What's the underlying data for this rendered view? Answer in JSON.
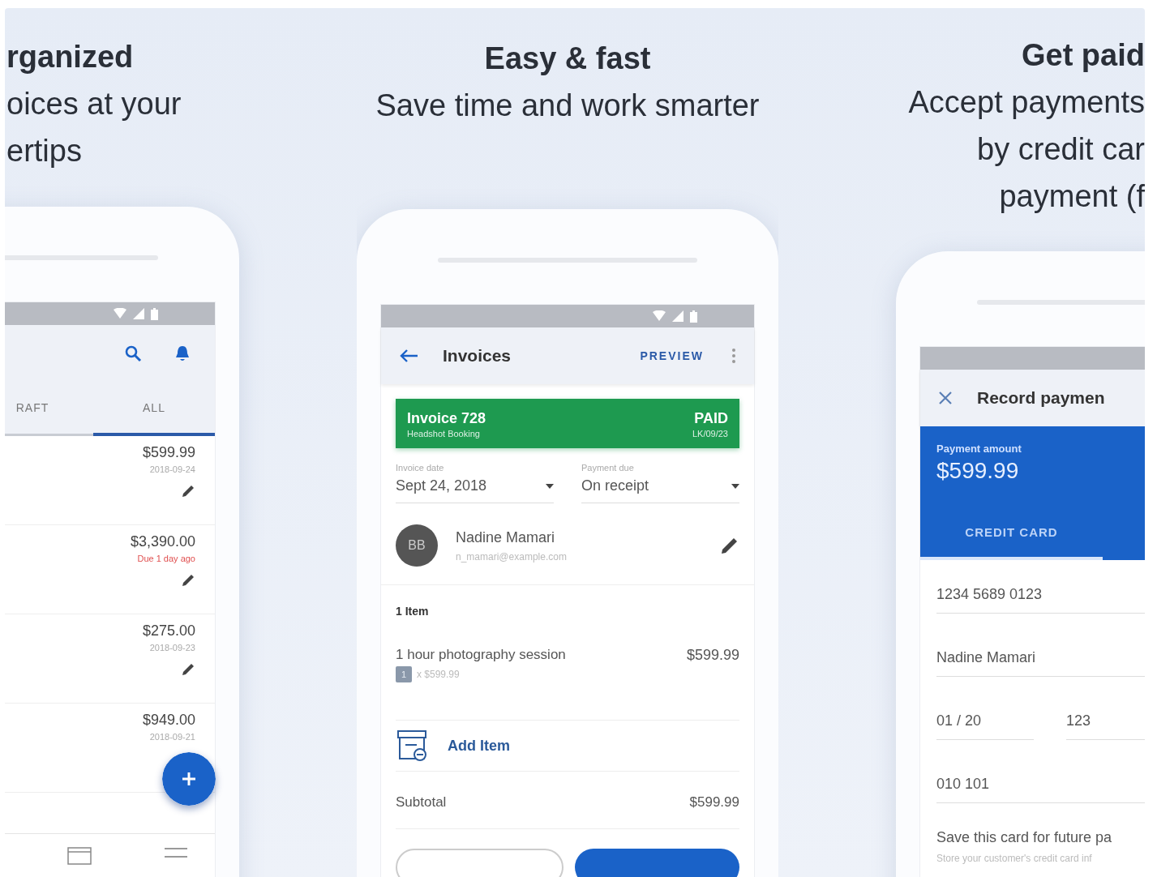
{
  "panels": [
    {
      "kind": "list",
      "headline": [
        "rganized",
        "oices at your",
        "ertips"
      ],
      "phone": {
        "tabs": [
          {
            "label": "RAFT",
            "selected": false
          },
          {
            "label": "ALL",
            "selected": true
          }
        ],
        "invoices": [
          {
            "amount": "$599.99",
            "note": "2018-09-24",
            "overdue": false
          },
          {
            "amount": "$3,390.00",
            "note": "Due 1 day ago",
            "overdue": true
          },
          {
            "amount": "$275.00",
            "note": "2018-09-23",
            "overdue": false
          },
          {
            "amount": "$949.00",
            "note": "2018-09-21",
            "overdue": false
          }
        ]
      }
    },
    {
      "kind": "invoice",
      "headline": [
        "Easy & fast",
        "Save time and work smarter"
      ],
      "phone": {
        "title": "Invoices",
        "action": "PREVIEW",
        "status_card": {
          "title": "Invoice 728",
          "subtitle": "Headshot Booking",
          "status": "PAID",
          "ref": "LK/09/23"
        },
        "fields": [
          {
            "label": "Invoice date",
            "value": "Sept 24, 2018"
          },
          {
            "label": "Payment due",
            "value": "On receipt"
          }
        ],
        "client": {
          "initials": "BB",
          "name": "Nadine Mamari",
          "email": "n_mamari@example.com"
        },
        "items_heading": "1 Item",
        "items": [
          {
            "name": "1 hour photography session",
            "qty": "1",
            "unit": "x $599.99",
            "total": "$599.99"
          }
        ],
        "add_item": "Add Item",
        "subtotal": {
          "label": "Subtotal",
          "value": "$599.99"
        },
        "buttons": [
          {
            "kind": "outline"
          },
          {
            "kind": "filled"
          }
        ]
      }
    },
    {
      "kind": "payment",
      "headline": [
        "Get paid",
        "Accept payments",
        "by credit car",
        "payment (f"
      ],
      "phone": {
        "title": "Record paymen",
        "header": {
          "label": "Payment amount",
          "amount": "$599.99"
        },
        "tabs": [
          {
            "label": "CREDIT CARD",
            "selected": true
          }
        ],
        "fields": [
          {
            "cells": [
              "1234 5689 0123"
            ]
          },
          {
            "cells": [
              "Nadine Mamari"
            ]
          },
          {
            "cells": [
              "01 / 20",
              "123"
            ]
          },
          {
            "cells": [
              "010 101"
            ]
          }
        ],
        "save": {
          "title": "Save this card for future pa",
          "hint": "Store your customer's credit card inf"
        }
      }
    }
  ]
}
